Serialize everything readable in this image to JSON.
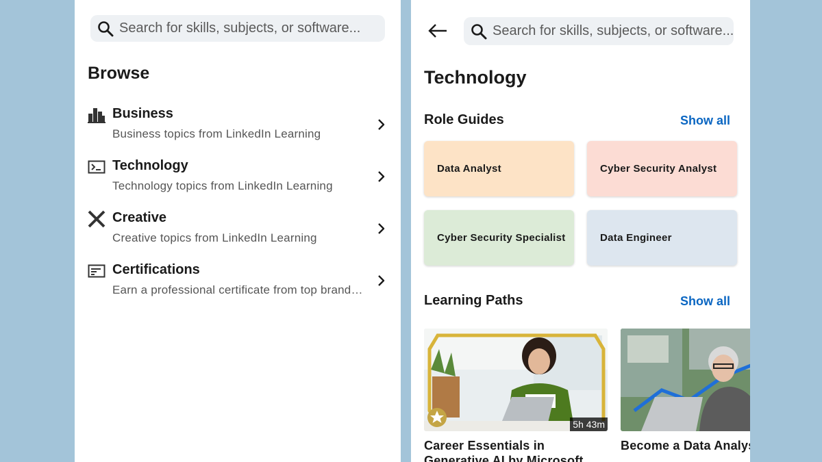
{
  "browse": {
    "search_placeholder": "Search for skills, subjects, or software...",
    "title": "Browse",
    "categories": [
      {
        "name": "Business",
        "desc": "Business topics from LinkedIn Learning",
        "icon": "bar-chart-icon"
      },
      {
        "name": "Technology",
        "desc": "Technology topics from LinkedIn Learning",
        "icon": "terminal-icon"
      },
      {
        "name": "Creative",
        "desc": "Creative topics from LinkedIn Learning",
        "icon": "creative-tools-icon"
      },
      {
        "name": "Certifications",
        "desc": "Earn a professional certificate from top brands or industry",
        "icon": "certificate-icon"
      }
    ]
  },
  "technology": {
    "search_placeholder": "Search for skills, subjects, or software...",
    "title": "Technology",
    "role_guides": {
      "title": "Role Guides",
      "show_all": "Show all",
      "items": [
        {
          "label": "Data Analyst",
          "color": "#fde3c6"
        },
        {
          "label": "Cyber Security Analyst",
          "color": "#fcdcd4"
        },
        {
          "label": "Cyber Security Specialist",
          "color": "#dcebd7"
        },
        {
          "label": "Data Engineer",
          "color": "#dde6ef"
        }
      ]
    },
    "learning_paths": {
      "title": "Learning Paths",
      "show_all": "Show all",
      "items": [
        {
          "title": "Career Essentials in Generative AI by Microsoft and LinkedIn",
          "duration": "5h 43m"
        },
        {
          "title": "Become a Data Analyst",
          "duration": ""
        }
      ]
    }
  },
  "colors": {
    "background": "#a3c4d9",
    "link": "#0a66c2"
  }
}
